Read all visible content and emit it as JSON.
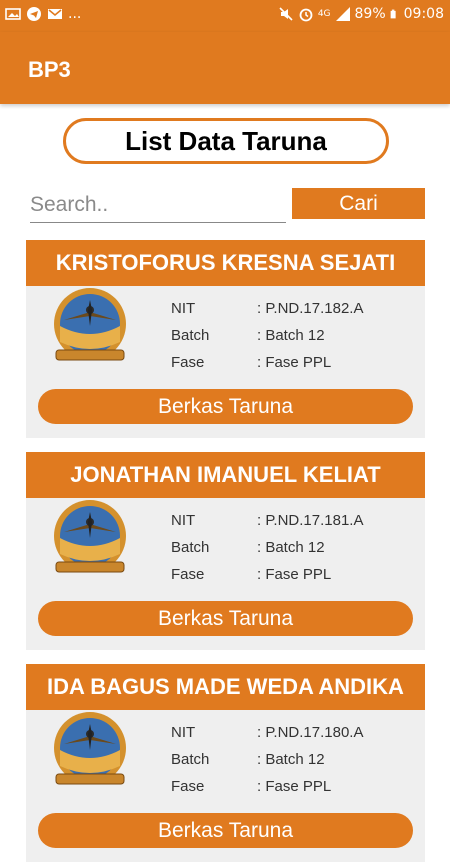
{
  "status_bar": {
    "left_icons": [
      "image-icon",
      "telegram-icon",
      "gmail-icon"
    ],
    "more": "...",
    "right_icons": [
      "mute-icon",
      "alarm-icon",
      "signal-icon",
      "battery-icon"
    ],
    "network": "4G",
    "battery": "89%",
    "time": "09:08"
  },
  "app_bar": {
    "title": "BP3"
  },
  "page": {
    "title": "List Data Taruna"
  },
  "search": {
    "placeholder": "Search..",
    "value": "",
    "button_label": "Cari"
  },
  "labels": {
    "nit": "NIT",
    "batch": "Batch",
    "fase": "Fase"
  },
  "cadets": [
    {
      "name": "KRISTOFORUS KRESNA SEJATI",
      "nit": ": P.ND.17.182.A",
      "batch": ": Batch 12",
      "fase": ": Fase PPL",
      "button_label": "Berkas Taruna"
    },
    {
      "name": "JONATHAN IMANUEL KELIAT",
      "nit": ": P.ND.17.181.A",
      "batch": ": Batch 12",
      "fase": ": Fase PPL",
      "button_label": "Berkas Taruna"
    },
    {
      "name": "IDA BAGUS MADE WEDA ANDIKA",
      "nit": ": P.ND.17.180.A",
      "batch": ": Batch 12",
      "fase": ": Fase PPL",
      "button_label": "Berkas Taruna"
    }
  ],
  "colors": {
    "primary": "#e07a1f",
    "card_bg": "#efefef",
    "text": "#333333"
  }
}
